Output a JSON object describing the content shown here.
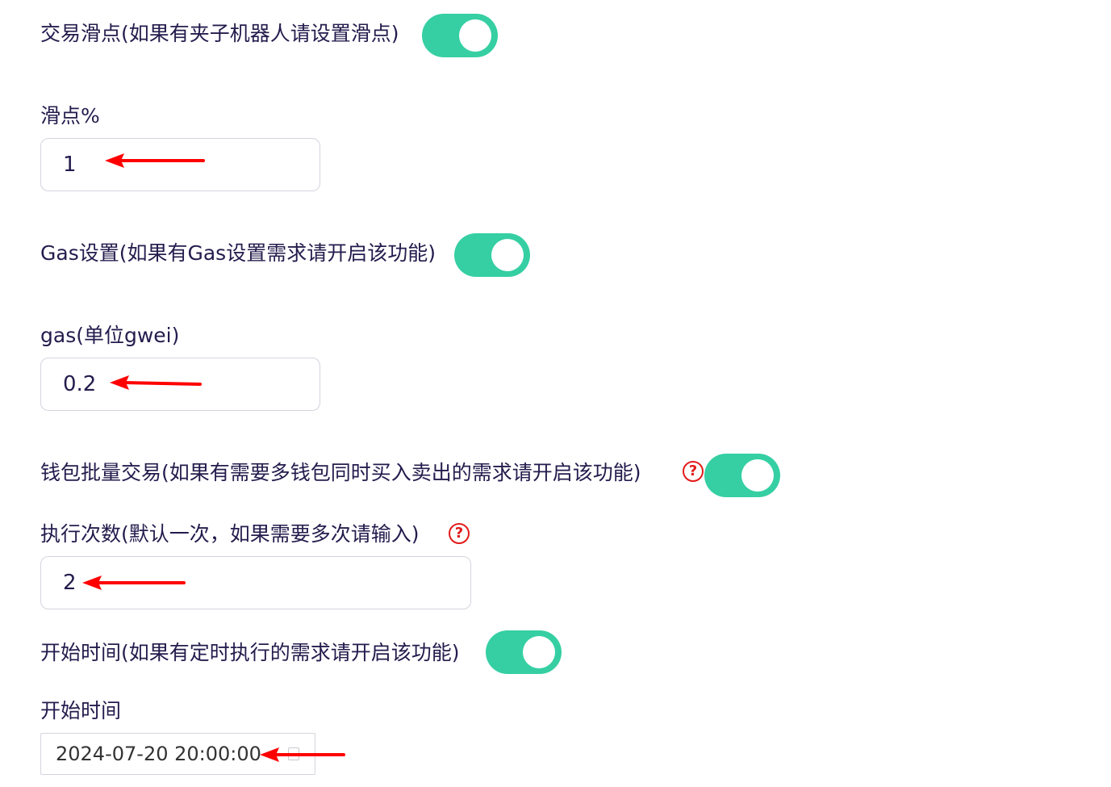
{
  "settings": {
    "slippage_toggle_label": "交易滑点(如果有夹子机器人请设置滑点)",
    "slippage_toggle_on": true,
    "slippage_label": "滑点%",
    "slippage_value": "1",
    "gas_toggle_label": "Gas设置(如果有Gas设置需求请开启该功能)",
    "gas_toggle_on": true,
    "gas_label": "gas(单位gwei)",
    "gas_value": "0.2",
    "batch_toggle_label": "钱包批量交易(如果有需要多钱包同时买入卖出的需求请开启该功能)",
    "batch_toggle_on": true,
    "exec_label": "执行次数(默认一次，如果需要多次请输入)",
    "exec_value": "2",
    "schedule_toggle_label": "开始时间(如果有定时执行的需求请开启该功能)",
    "schedule_toggle_on": true,
    "start_time_label": "开始时间",
    "start_time_value": "2024-07-20 20:00:00"
  },
  "icons": {
    "help": "question-circle-icon",
    "calendar": "calendar-icon",
    "annotation": "red-arrow-icon"
  },
  "colors": {
    "toggle_on": "#35cfa3",
    "text": "#241c4d",
    "help_icon": "#e21b1b",
    "annotation_arrow": "#ff0000"
  },
  "help_glyph": "?"
}
